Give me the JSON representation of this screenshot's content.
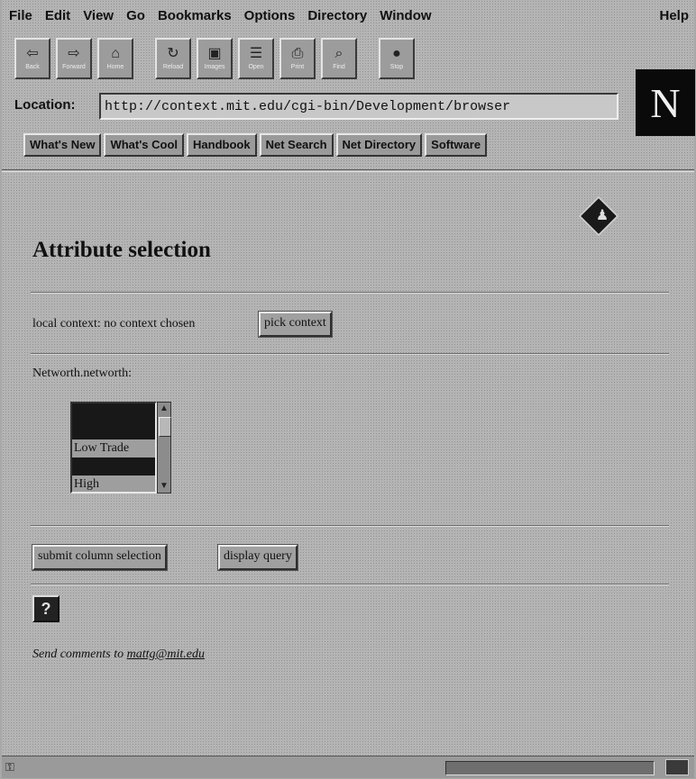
{
  "menu": [
    "File",
    "Edit",
    "View",
    "Go",
    "Bookmarks",
    "Options",
    "Directory",
    "Window"
  ],
  "menu_help": "Help",
  "toolbar": [
    {
      "label": "Back",
      "icon": "back-arrow-icon",
      "glyph": "⇦"
    },
    {
      "label": "Forward",
      "icon": "forward-arrow-icon",
      "glyph": "⇨"
    },
    {
      "label": "Home",
      "icon": "home-icon",
      "glyph": "⌂"
    },
    {
      "label": "Reload",
      "icon": "reload-icon",
      "glyph": "↻"
    },
    {
      "label": "Images",
      "icon": "images-icon",
      "glyph": "▣"
    },
    {
      "label": "Open",
      "icon": "open-icon",
      "glyph": "☰"
    },
    {
      "label": "Print",
      "icon": "print-icon",
      "glyph": "⎙"
    },
    {
      "label": "Find",
      "icon": "find-icon",
      "glyph": "⌕"
    },
    {
      "label": "Stop",
      "icon": "stop-icon",
      "glyph": "●"
    }
  ],
  "location": {
    "label": "Location:",
    "url": "http://context.mit.edu/cgi-bin/Development/browser"
  },
  "logo": "N",
  "directory_buttons": [
    "What's New",
    "What's Cool",
    "Handbook",
    "Net Search",
    "Net Directory",
    "Software"
  ],
  "page": {
    "title": "Attribute selection",
    "context_label": "local context:  no context chosen",
    "pick_context": "pick context",
    "field_label": "Networth.networth:",
    "options": [
      {
        "text": "",
        "selected": true
      },
      {
        "text": "",
        "selected": true
      },
      {
        "text": "Low  Trade",
        "selected": false
      },
      {
        "text": "",
        "selected": true
      },
      {
        "text": "High",
        "selected": false
      }
    ],
    "submit": "submit column selection",
    "display_query": "display query",
    "help_glyph": "?",
    "comments_prefix": "Send comments to",
    "comments_email": "mattg@mit.edu"
  }
}
